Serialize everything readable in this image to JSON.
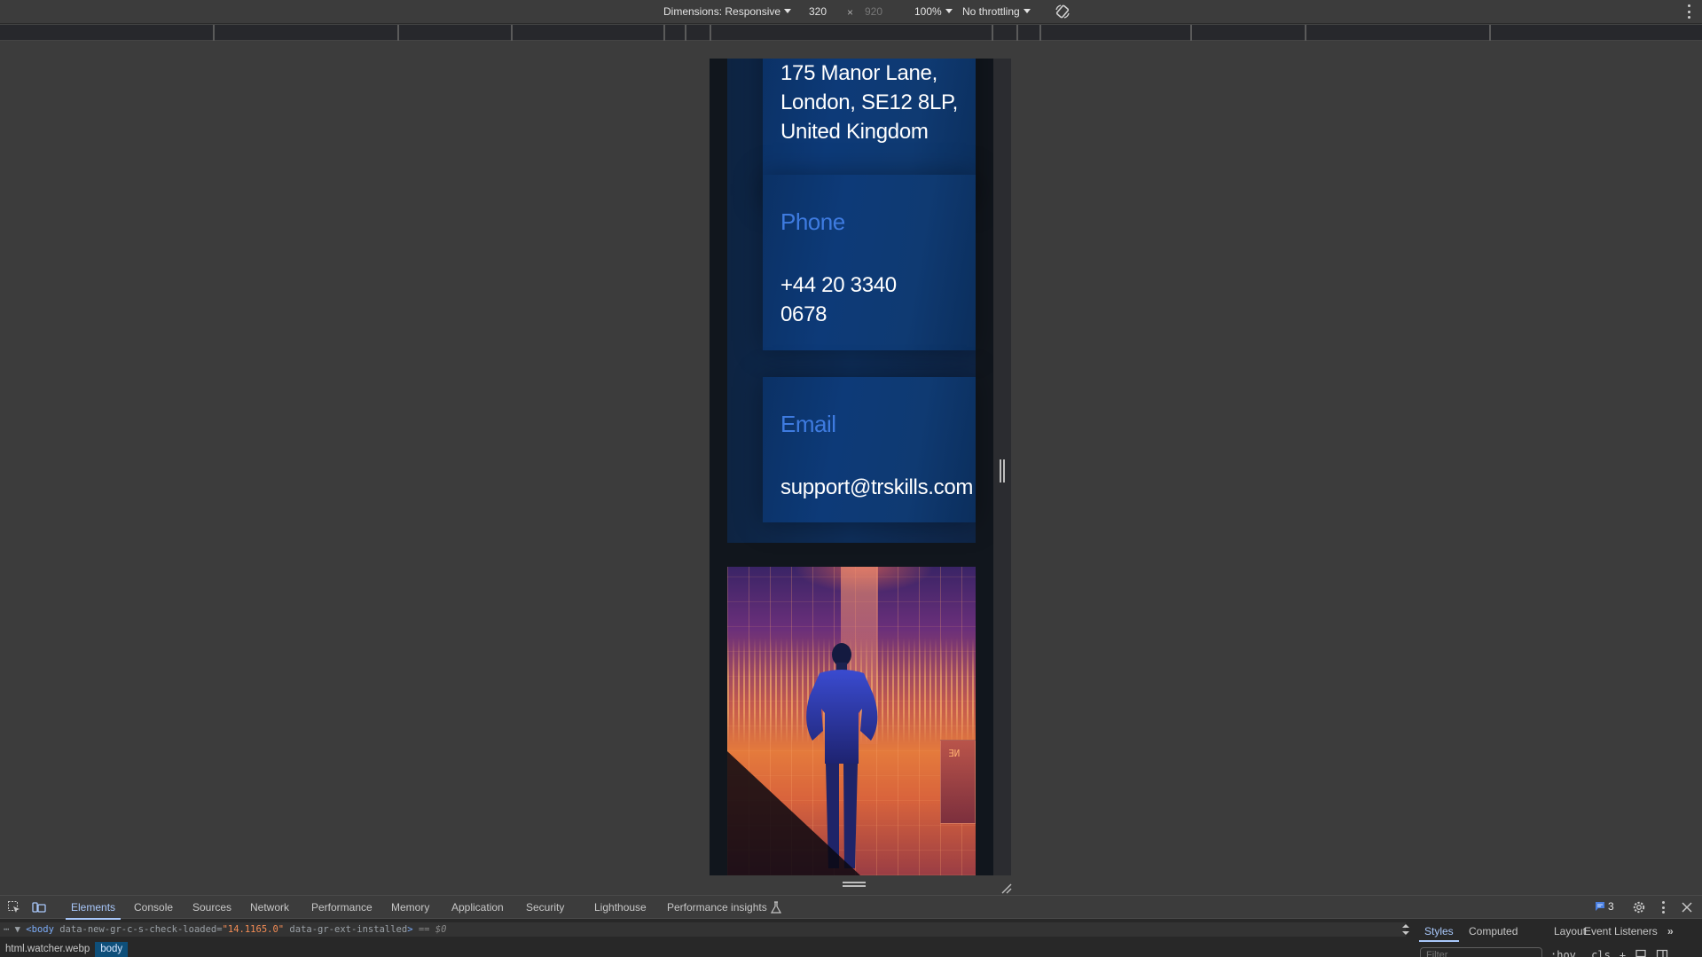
{
  "device_toolbar": {
    "dimensions_label": "Dimensions: Responsive",
    "width_value": "320",
    "times": "×",
    "height_placeholder": "920",
    "zoom_label": "100%",
    "throttling_label": "No throttling"
  },
  "page": {
    "address": {
      "partial_line": "175 Manor Lane,",
      "line2": "London, SE12 8LP,",
      "line3": "United Kingdom"
    },
    "phone": {
      "label": "Phone",
      "line1": "+44 20 3340",
      "line2": "0678"
    },
    "email": {
      "label": "Email",
      "value": "support@trskills.com"
    },
    "hero_image_text": "ƎИ"
  },
  "devtools": {
    "tabs": [
      "Elements",
      "Console",
      "Sources",
      "Network",
      "Performance",
      "Memory",
      "Application",
      "Security",
      "Lighthouse",
      "Performance insights"
    ],
    "issues_count": "3",
    "dom_line": {
      "prefix": "⋯ ▼",
      "tag_open": "<body",
      "attr1_name": " data-new-gr-c-s-check-loaded=",
      "attr1_value": "\"14.1165.0\"",
      "attr2": " data-gr-ext-installed",
      "tag_close": ">",
      "selected_marker": " == $0"
    },
    "breadcrumbs": [
      "html.watcher.webp",
      "body"
    ],
    "styles_tabs": [
      "Styles",
      "Computed",
      "Layout",
      "Event Listeners",
      "»"
    ],
    "filter_placeholder": "Filter",
    "styles_tools": [
      ":hov",
      ".cls",
      "+"
    ]
  },
  "colors": {
    "accent_label": "#3e7be0",
    "card_bg": "#0d3a78",
    "devtools_accent": "#a8c7fa"
  }
}
